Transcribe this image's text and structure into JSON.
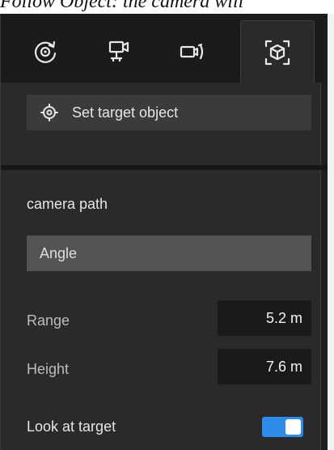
{
  "caption": "Follow Object: the camera will",
  "tabs": [
    {
      "icon": "orbit-icon"
    },
    {
      "icon": "tripod-camera-icon"
    },
    {
      "icon": "camera-rotate-icon"
    },
    {
      "icon": "object-cube-icon",
      "active": true
    }
  ],
  "target": {
    "button_label": "Set target object",
    "icon": "crosshair-target-icon"
  },
  "camera_path": {
    "label": "camera path",
    "mode_value": "Angle"
  },
  "range": {
    "label": "Range",
    "value": "5.2 m"
  },
  "height": {
    "label": "Height",
    "value": "7.6 m"
  },
  "look_at_target": {
    "label": "Look at target",
    "enabled": true
  },
  "colors": {
    "panel_bg": "#2a2a2d",
    "accent": "#2f8ce8"
  }
}
